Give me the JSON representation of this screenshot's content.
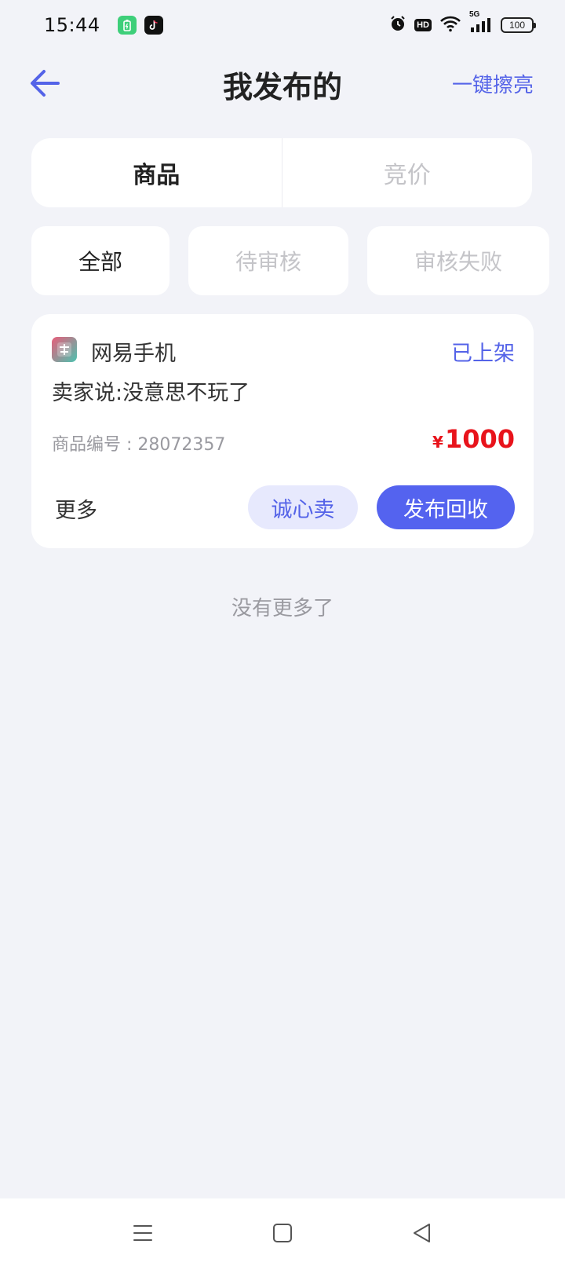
{
  "status_bar": {
    "time": "15:44",
    "app_icons": [
      "battery-saver-icon",
      "tiktok-icon"
    ],
    "system_icons": [
      "alarm-icon",
      "hd-icon",
      "wifi-icon",
      "signal-5g-icon"
    ],
    "hd_label": "HD",
    "network_label": "5G",
    "battery_level": "100"
  },
  "header": {
    "title": "我发布的",
    "action_label": "一键擦亮"
  },
  "type_tabs": [
    {
      "label": "商品",
      "active": true
    },
    {
      "label": "竞价",
      "active": false
    }
  ],
  "filters": [
    {
      "label": "全部",
      "active": true
    },
    {
      "label": "待审核",
      "active": false
    },
    {
      "label": "审核失败",
      "active": false
    }
  ],
  "item": {
    "game_name": "网易手机",
    "status": "已上架",
    "seller_note": "卖家说:没意思不玩了",
    "code_label": "商品编号 : 28072357",
    "currency": "¥",
    "price": "1000",
    "more_label": "更多",
    "sincere_label": "诚心卖",
    "recycle_label": "发布回收"
  },
  "list_end_text": "没有更多了",
  "nav_bar": {
    "icons": [
      "menu-icon",
      "home-icon",
      "back-triangle-icon"
    ]
  },
  "colors": {
    "accent": "#5463e8",
    "price": "#e8131b",
    "background": "#f2f3f8"
  }
}
